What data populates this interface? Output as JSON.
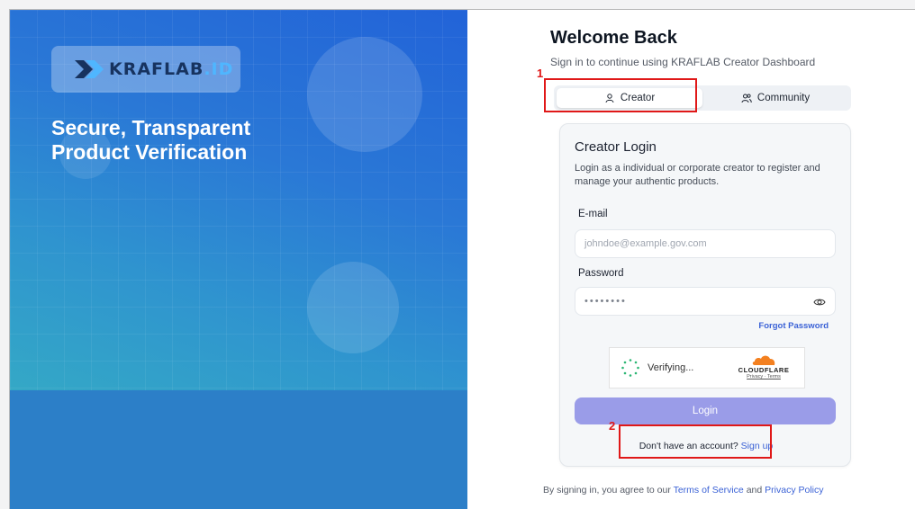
{
  "brand": {
    "logo_text": "KRAFLAB",
    "logo_suffix": ".ID"
  },
  "hero": {
    "headline": "Secure, Transparent Product Verification"
  },
  "header": {
    "title": "Welcome Back",
    "subtitle": "Sign in to continue using KRAFLAB Creator Dashboard"
  },
  "tabs": [
    {
      "label": "Creator",
      "icon": "user-icon",
      "active": true
    },
    {
      "label": "Community",
      "icon": "users-icon",
      "active": false
    }
  ],
  "card": {
    "title": "Creator Login",
    "description": "Login as a individual or corporate creator to register and manage your authentic products.",
    "email_label": "E-mail",
    "email_placeholder": "johndoe@example.gov.com",
    "password_label": "Password",
    "password_value": "••••••••",
    "forgot_label": "Forgot Password",
    "captcha": {
      "status": "Verifying...",
      "provider": "CLOUDFLARE",
      "links": "Privacy · Terms"
    },
    "login_label": "Login",
    "signup_prompt": "Don't have an account?",
    "signup_link": "Sign up"
  },
  "footer": {
    "prefix": "By signing in, you agree to our",
    "terms": "Terms of Service",
    "and": "and",
    "privacy": "Privacy Policy"
  },
  "annotations": [
    {
      "number": "1"
    },
    {
      "number": "2"
    }
  ],
  "colors": {
    "accent": "#3b62d6",
    "login_button": "#9a9ce8",
    "annotation": "#e01818",
    "hero": "#2a78d6"
  }
}
